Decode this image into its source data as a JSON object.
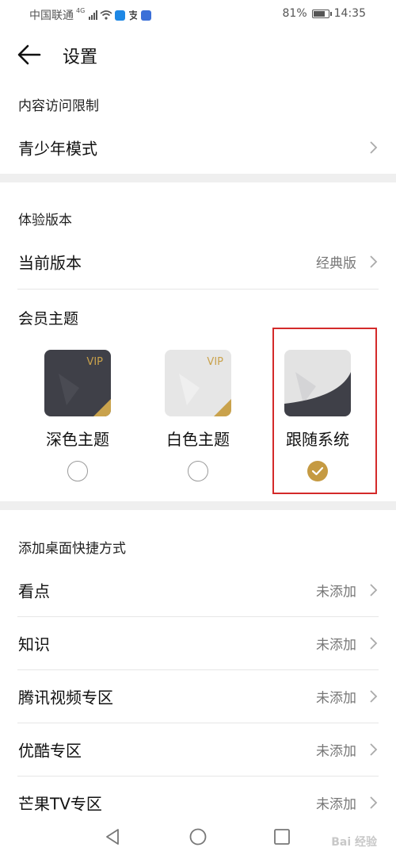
{
  "status_bar": {
    "carrier": "中国联通",
    "network": "4G",
    "battery": "81%",
    "battery_level": 0.81,
    "time": "14:35",
    "icons": [
      "signal-icon",
      "wifi-icon",
      "shield-app-icon",
      "alipay-icon",
      "app-notification-icon",
      "battery-icon"
    ]
  },
  "header": {
    "title": "设置"
  },
  "sections": {
    "content_restriction": {
      "label": "内容访问限制",
      "teen_mode": "青少年模式"
    },
    "experience": {
      "label": "体验版本",
      "current_version_label": "当前版本",
      "current_version_value": "经典版"
    },
    "member_theme": {
      "label": "会员主题",
      "themes": [
        {
          "name": "深色主题",
          "badge": "VIP",
          "selected": false
        },
        {
          "name": "白色主题",
          "badge": "VIP",
          "selected": false
        },
        {
          "name": "跟随系统",
          "badge": "",
          "selected": true
        }
      ]
    },
    "shortcuts": {
      "label": "添加桌面快捷方式",
      "items": [
        {
          "label": "看点",
          "value": "未添加"
        },
        {
          "label": "知识",
          "value": "未添加"
        },
        {
          "label": "腾讯视频专区",
          "value": "未添加"
        },
        {
          "label": "优酷专区",
          "value": "未添加"
        },
        {
          "label": "芒果TV专区",
          "value": "未添加"
        }
      ]
    }
  },
  "colors": {
    "accent_gold": "#c59a42",
    "highlight_red": "#d42a2a",
    "section_gap": "#efefef",
    "dark_theme": "#3f4048",
    "light_theme": "#e6e6e6"
  },
  "watermark": "Bai 经验"
}
